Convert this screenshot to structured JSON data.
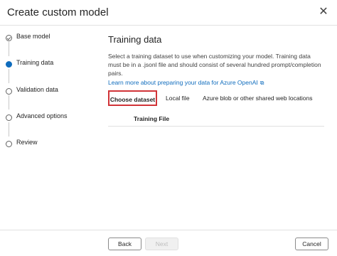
{
  "dialog": {
    "title": "Create custom model",
    "close_icon": "close-icon"
  },
  "steps": [
    {
      "label": "Base model",
      "status": "done"
    },
    {
      "label": "Training data",
      "status": "current"
    },
    {
      "label": "Validation data",
      "status": "pending"
    },
    {
      "label": "Advanced options",
      "status": "pending"
    },
    {
      "label": "Review",
      "status": "pending"
    }
  ],
  "main": {
    "title": "Training data",
    "description": "Select a training dataset to use when customizing your model. Training data must be in a .jsonl file and should consist of several hundred prompt/completion pairs.",
    "learn_more": "Learn more about preparing your data for Azure OpenAI",
    "external_icon": "external-link-icon",
    "tabs": [
      {
        "label": "Choose dataset",
        "selected": true
      },
      {
        "label": "Local file",
        "selected": false
      },
      {
        "label": "Azure blob or other shared web locations",
        "selected": false
      }
    ],
    "table": {
      "columns": [
        "Training File"
      ]
    }
  },
  "footer": {
    "back": "Back",
    "next": "Next",
    "cancel": "Cancel"
  },
  "colors": {
    "accent": "#0f6cbd",
    "highlight": "#d13438"
  }
}
